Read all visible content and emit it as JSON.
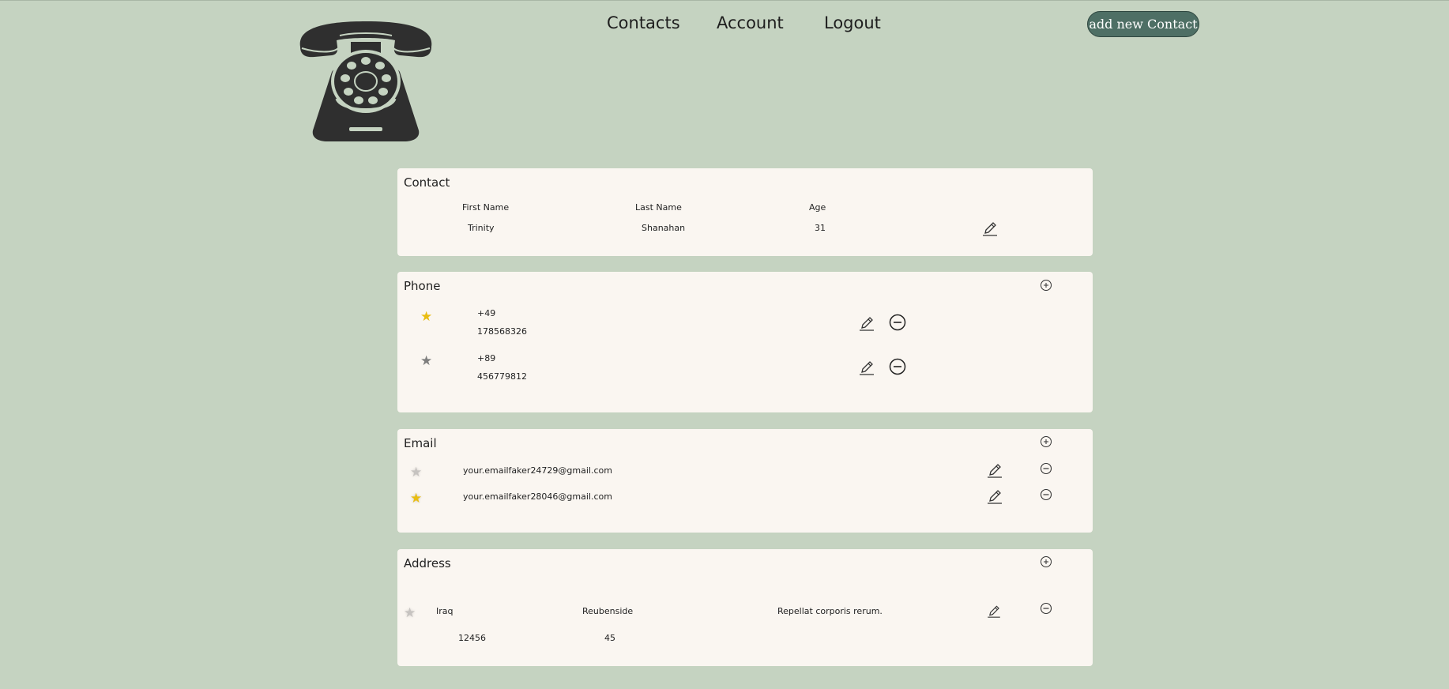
{
  "nav": {
    "items": [
      {
        "label": "Contacts"
      },
      {
        "label": "Account"
      },
      {
        "label": "Logout"
      }
    ],
    "add_button_label": "add new Contact"
  },
  "logo": {
    "icon": "telephone-icon"
  },
  "contact": {
    "title": "Contact",
    "headers": {
      "first_name": "First Name",
      "last_name": "Last Name",
      "age": "Age"
    },
    "first_name": "Trinity",
    "last_name": "Shanahan",
    "age": "31"
  },
  "phone": {
    "title": "Phone",
    "items": [
      {
        "favorite": true,
        "code": "+49",
        "number": "178568326"
      },
      {
        "favorite": false,
        "code": "+89",
        "number": "456779812"
      }
    ]
  },
  "email": {
    "title": "Email",
    "items": [
      {
        "favorite": false,
        "address": "your.emailfaker24729@gmail.com"
      },
      {
        "favorite": true,
        "address": "your.emailfaker28046@gmail.com"
      }
    ]
  },
  "address": {
    "title": "Address",
    "items": [
      {
        "favorite": false,
        "country": "Iraq",
        "city": "Reubenside",
        "street": "Repellat corporis rerum.",
        "zip": "12456",
        "number": "45"
      }
    ]
  },
  "colors": {
    "background": "#c5d3c1",
    "card": "#faf6f1",
    "button": "#4e6f65",
    "star_favorite": "#e9bd12",
    "star_inactive": "#7e7e7e"
  }
}
